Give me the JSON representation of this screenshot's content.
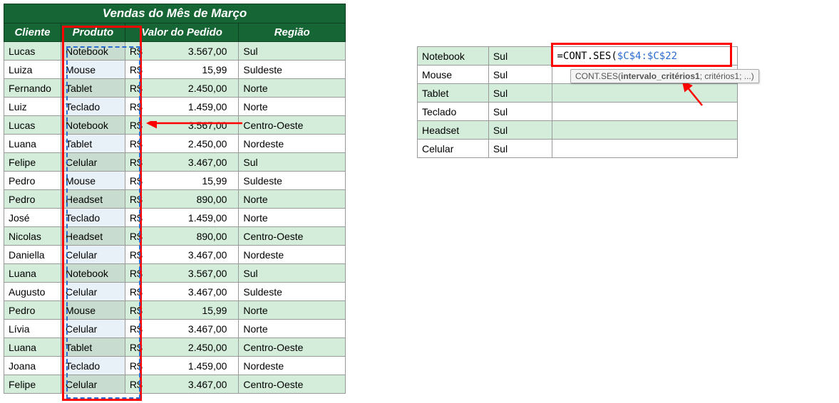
{
  "title": "Vendas do Mês de Março",
  "headers": {
    "cliente": "Cliente",
    "produto": "Produto",
    "valor": "Valor do Pedido",
    "regiao": "Região"
  },
  "currency": "R$",
  "rows": [
    {
      "cliente": "Lucas",
      "produto": "Notebook",
      "valor": "3.567,00",
      "regiao": "Sul"
    },
    {
      "cliente": "Luiza",
      "produto": "Mouse",
      "valor": "15,99",
      "regiao": "Suldeste"
    },
    {
      "cliente": "Fernando",
      "produto": "Tablet",
      "valor": "2.450,00",
      "regiao": "Norte"
    },
    {
      "cliente": "Luiz",
      "produto": "Teclado",
      "valor": "1.459,00",
      "regiao": "Norte"
    },
    {
      "cliente": "Lucas",
      "produto": "Notebook",
      "valor": "3.567,00",
      "regiao": "Centro-Oeste"
    },
    {
      "cliente": "Luana",
      "produto": "Tablet",
      "valor": "2.450,00",
      "regiao": "Nordeste"
    },
    {
      "cliente": "Felipe",
      "produto": "Celular",
      "valor": "3.467,00",
      "regiao": "Sul"
    },
    {
      "cliente": "Pedro",
      "produto": "Mouse",
      "valor": "15,99",
      "regiao": "Suldeste"
    },
    {
      "cliente": "Pedro",
      "produto": "Headset",
      "valor": "890,00",
      "regiao": "Norte"
    },
    {
      "cliente": "José",
      "produto": "Teclado",
      "valor": "1.459,00",
      "regiao": "Norte"
    },
    {
      "cliente": "Nicolas",
      "produto": "Headset",
      "valor": "890,00",
      "regiao": "Centro-Oeste"
    },
    {
      "cliente": "Daniella",
      "produto": "Celular",
      "valor": "3.467,00",
      "regiao": "Nordeste"
    },
    {
      "cliente": "Luana",
      "produto": "Notebook",
      "valor": "3.567,00",
      "regiao": "Sul"
    },
    {
      "cliente": "Augusto",
      "produto": "Celular",
      "valor": "3.467,00",
      "regiao": "Suldeste"
    },
    {
      "cliente": "Pedro",
      "produto": "Mouse",
      "valor": "15,99",
      "regiao": "Norte"
    },
    {
      "cliente": "Lívia",
      "produto": "Celular",
      "valor": "3.467,00",
      "regiao": "Norte"
    },
    {
      "cliente": "Luana",
      "produto": "Tablet",
      "valor": "2.450,00",
      "regiao": "Centro-Oeste"
    },
    {
      "cliente": "Joana",
      "produto": "Teclado",
      "valor": "1.459,00",
      "regiao": "Nordeste"
    },
    {
      "cliente": "Felipe",
      "produto": "Celular",
      "valor": "3.467,00",
      "regiao": "Centro-Oeste"
    }
  ],
  "right_rows": [
    {
      "produto": "Notebook",
      "regiao": "Sul"
    },
    {
      "produto": "Mouse",
      "regiao": "Sul"
    },
    {
      "produto": "Tablet",
      "regiao": "Sul"
    },
    {
      "produto": "Teclado",
      "regiao": "Sul"
    },
    {
      "produto": "Headset",
      "regiao": "Sul"
    },
    {
      "produto": "Celular",
      "regiao": "Sul"
    }
  ],
  "formula": {
    "prefix": "=CONT.SES(",
    "ref": "$C$4:$C$22"
  },
  "tooltip": {
    "func": "CONT.SES(",
    "bold": "intervalo_critérios1",
    "rest": "; critérios1; ...)"
  }
}
